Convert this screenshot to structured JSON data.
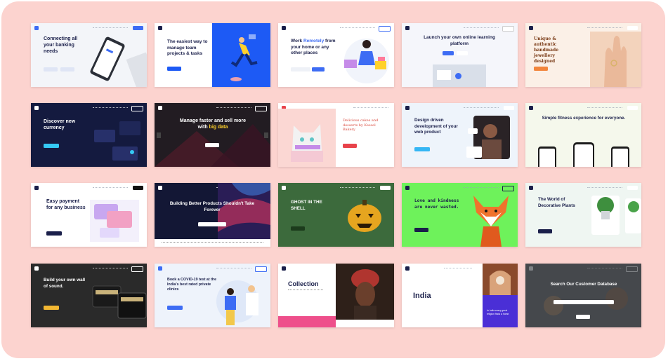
{
  "colors": {
    "background": "#fcd3cf",
    "accent_blue": "#3d6cf4",
    "navy": "#1a1f4a",
    "green": "#6ef25b",
    "pink": "#ee4f8b"
  },
  "cards": [
    {
      "name": "banking",
      "headline": "Connecting all your banking needs",
      "logo": "Finapp"
    },
    {
      "name": "team-projects",
      "headline": "The easiest way to manage team projects & tasks",
      "logo": "Finapp"
    },
    {
      "name": "work-remotely",
      "headline_pre": "Work ",
      "headline_accent": "Remotely",
      "headline_post": " from your home or any other places",
      "logo": "Finapp"
    },
    {
      "name": "learning-platform",
      "headline": "Launch your own online learning platform",
      "logo": "Finapp"
    },
    {
      "name": "jewellery",
      "headline": "Unique & authentic handmade jewellery designed",
      "logo": "Finapp"
    },
    {
      "name": "currency",
      "headline": "Discover new currency",
      "logo": "Finapp"
    },
    {
      "name": "big-data",
      "headline_pre": "Manage faster and sell more with ",
      "headline_accent": "big data",
      "logo": "Finapp"
    },
    {
      "name": "cakes",
      "headline": "Delicious cakes and desserts by Kessel Bakery",
      "logo": "Finapp"
    },
    {
      "name": "web-product",
      "headline": "Design driven development of your web product",
      "logo": "Finapp"
    },
    {
      "name": "fitness",
      "headline": "Simple fitness experience for everyone.",
      "logo": "Finapp"
    },
    {
      "name": "payment",
      "headline": "Easy payment for any business",
      "logo": "Finapp"
    },
    {
      "name": "better-products",
      "headline": "Building Better Products Shouldn't Take Forever",
      "logo": "Finapp"
    },
    {
      "name": "ghost",
      "headline": "GHOST IN THE SHELL",
      "logo": "Finapp"
    },
    {
      "name": "love-kindness",
      "headline": "Love and kindness are never wasted.",
      "logo": "Finapp"
    },
    {
      "name": "plants",
      "headline": "The World of Decorative Plants",
      "logo": "Finapp"
    },
    {
      "name": "sound",
      "headline": "Build your own wall of sound.",
      "logo": "Finapp"
    },
    {
      "name": "covid",
      "headline": "Book a COVID-19 test at the India's best rated private clinics",
      "logo": "Finapp"
    },
    {
      "name": "collection",
      "headline": "Collection",
      "logo": "Finapp"
    },
    {
      "name": "india",
      "headline": "India",
      "tagline": "In India every great religion finds a home.",
      "logo": "Finapp"
    },
    {
      "name": "customer-db",
      "headline": "Search Our Customer Database",
      "logo": "Finapp"
    }
  ]
}
